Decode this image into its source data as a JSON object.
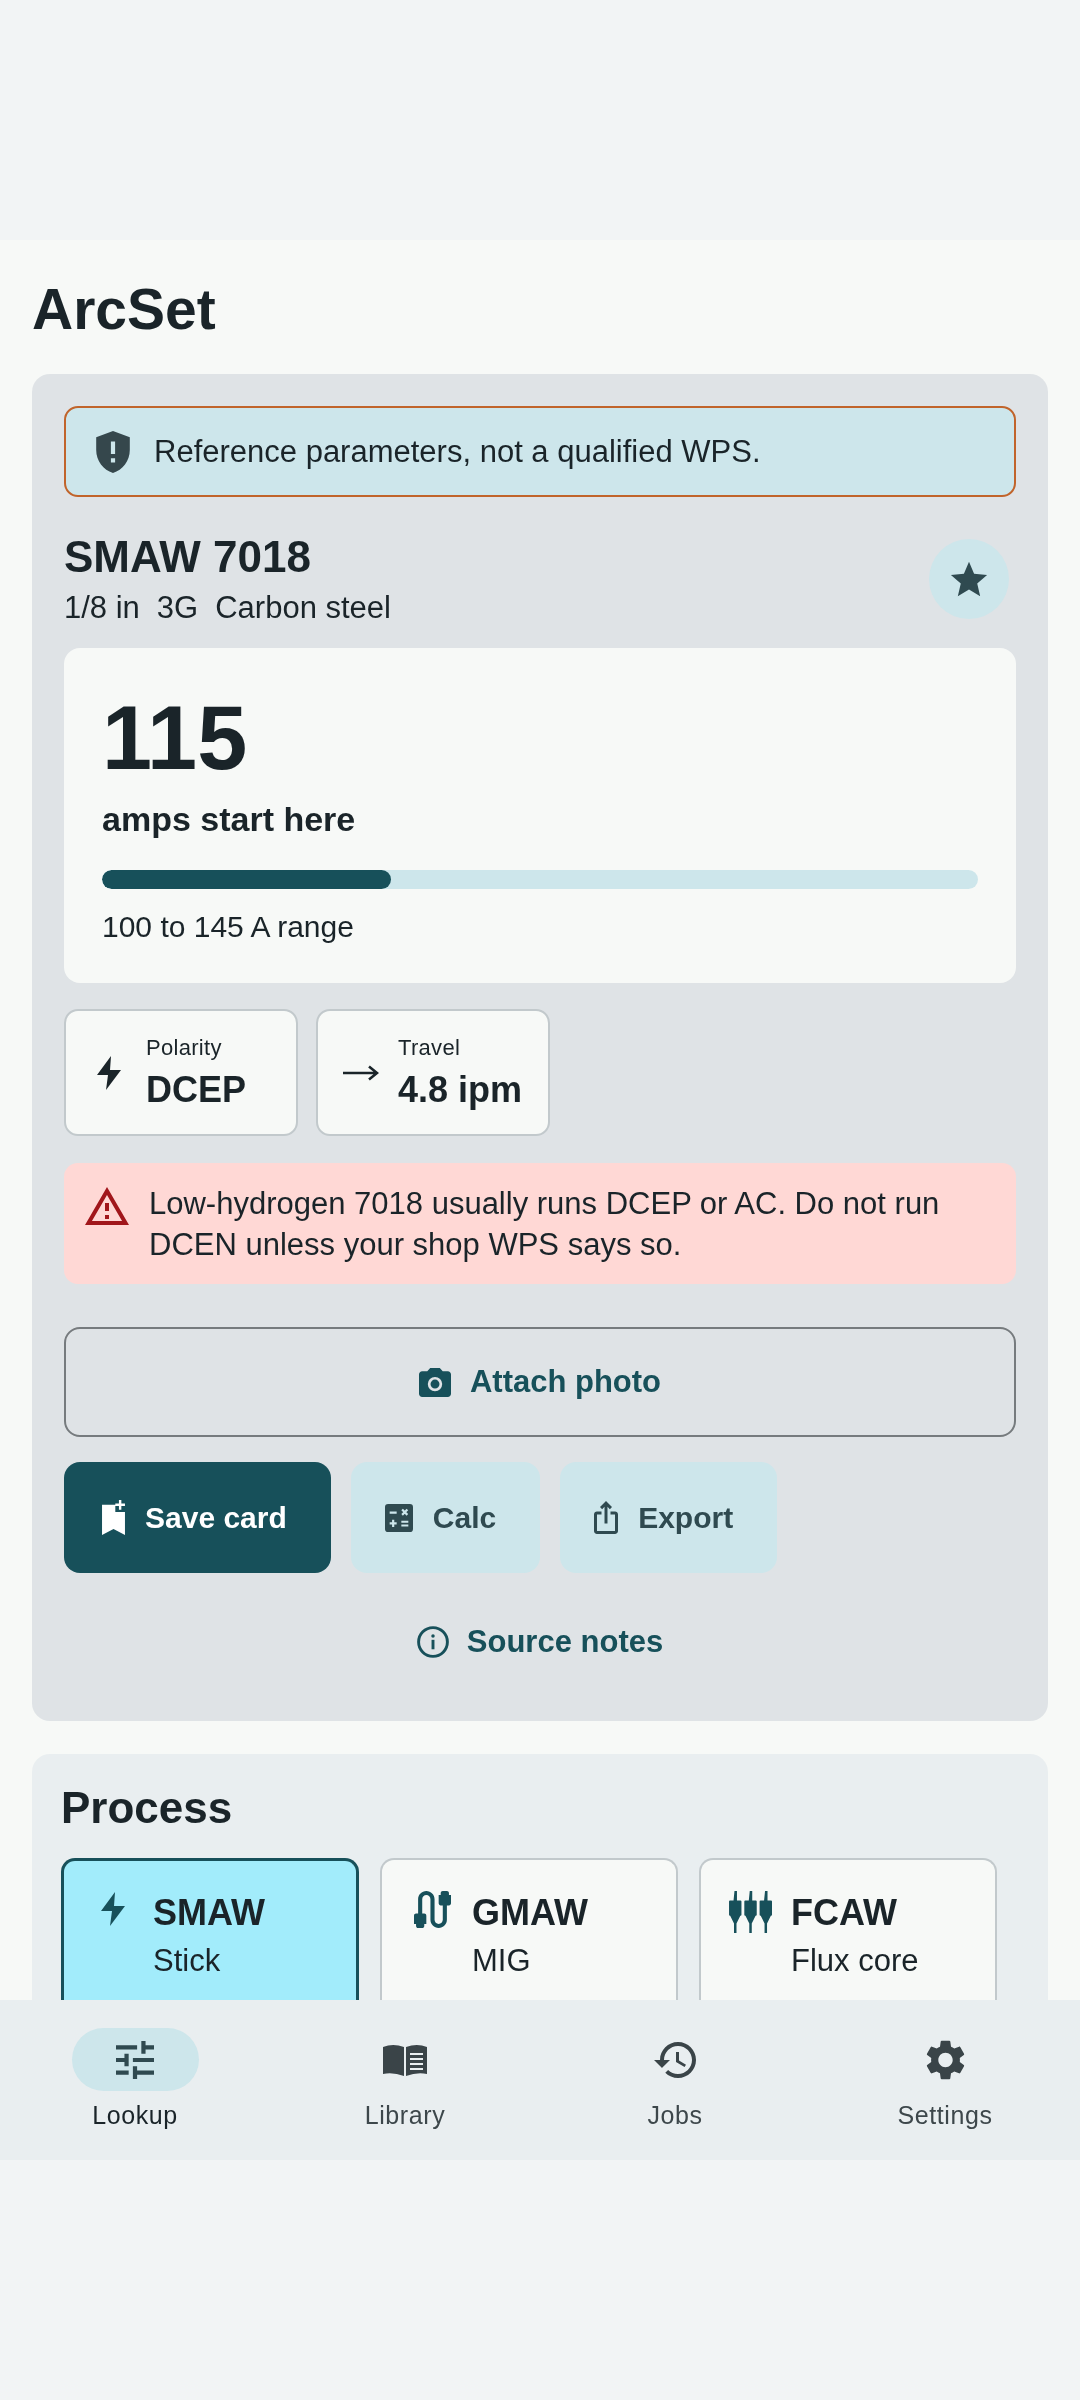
{
  "app": {
    "title": "ArcSet"
  },
  "notice": {
    "text": "Reference parameters, not a qualified WPS."
  },
  "electrode": {
    "title": "SMAW 7018",
    "specs": [
      "1/8 in",
      "3G",
      "Carbon steel"
    ],
    "starred": true
  },
  "amperage": {
    "value": "115",
    "caption": "amps start here",
    "level": 0.33,
    "range": "100 to 145 A range"
  },
  "stats": [
    {
      "kind": "polarity",
      "label": "Polarity",
      "value": "DCEP"
    },
    {
      "kind": "travel",
      "label": "Travel",
      "value": "4.8 ipm"
    }
  ],
  "warning": {
    "text": "Low-hydrogen 7018 usually runs DCEP or AC. Do not run DCEN unless your shop WPS says so."
  },
  "attach_button": {
    "label": "Attach photo"
  },
  "actions": [
    {
      "kind": "save",
      "label": "Save card"
    },
    {
      "kind": "calc",
      "label": "Calc"
    },
    {
      "kind": "export",
      "label": "Export"
    }
  ],
  "source_link": {
    "label": "Source notes"
  },
  "process": {
    "title": "Process",
    "options": [
      {
        "kind": "smaw",
        "name": "SMAW",
        "detail": "Stick",
        "selected": true
      },
      {
        "kind": "gmaw",
        "name": "GMAW",
        "detail": "MIG",
        "selected": false
      },
      {
        "kind": "fcaw",
        "name": "FCAW",
        "detail": "Flux core",
        "selected": false
      }
    ]
  },
  "nav": [
    {
      "kind": "lookup",
      "label": "Lookup",
      "selected": true
    },
    {
      "kind": "library",
      "label": "Library",
      "selected": false
    },
    {
      "kind": "jobs",
      "label": "Jobs",
      "selected": false
    },
    {
      "kind": "settings",
      "label": "Settings",
      "selected": false
    }
  ]
}
